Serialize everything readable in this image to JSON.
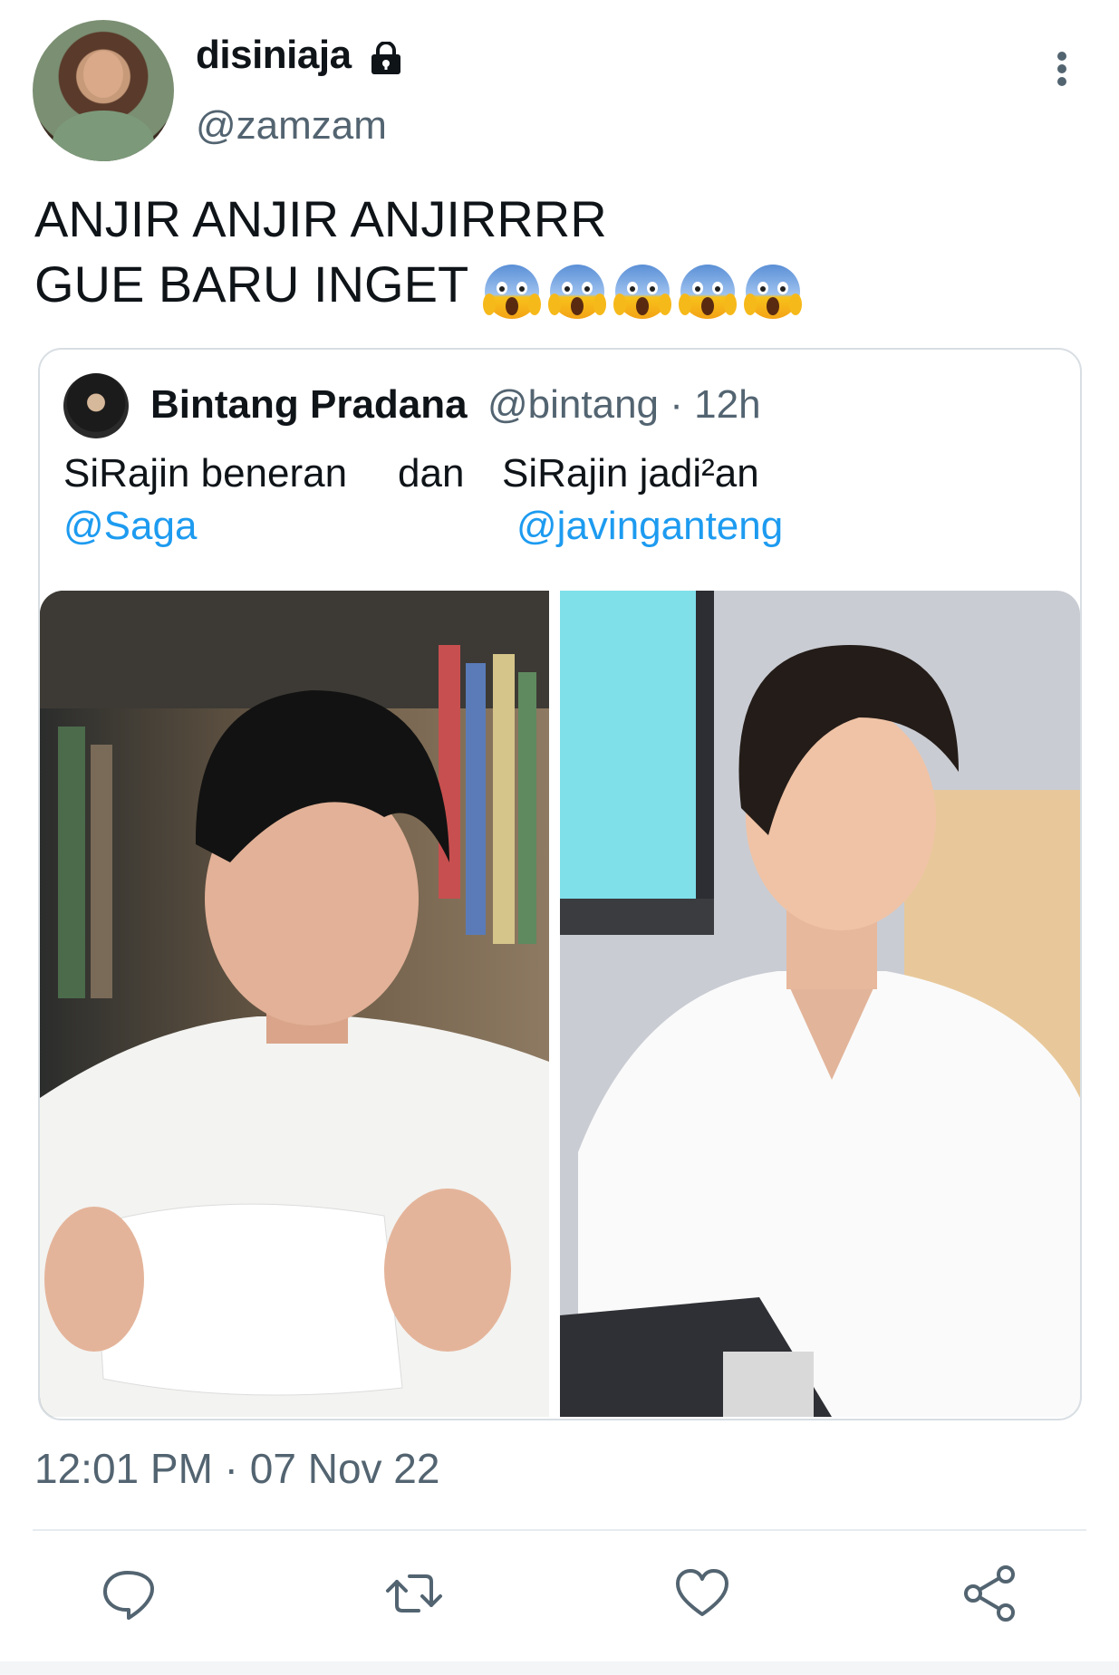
{
  "tweet": {
    "display_name": "disiniaja",
    "username": "@zamzam",
    "text_line1": "ANJIR ANJIR ANJIRRRR",
    "text_line2": "GUE BARU INGET",
    "emojis": [
      "😱",
      "😱",
      "😱",
      "😱",
      "😱"
    ],
    "timestamp": "12:01 PM · 07 Nov 22",
    "locked": true
  },
  "quote": {
    "display_name": "Bintang Pradana",
    "handle_time": "@bintang · 12h",
    "line1_left": "SiRajin beneran",
    "line1_mid": "dan",
    "line1_right": "SiRajin jadi²an",
    "mention_left": "@Saga",
    "mention_right": "@javinganteng"
  },
  "icons": {
    "lock": "lock-icon",
    "more": "more-vertical-icon",
    "reply": "reply-icon",
    "retweet": "retweet-icon",
    "like": "heart-icon",
    "share": "share-icon"
  },
  "colors": {
    "text": "#0f1419",
    "secondary": "#536471",
    "mention": "#1d9bf0",
    "border": "#d8dee3"
  }
}
